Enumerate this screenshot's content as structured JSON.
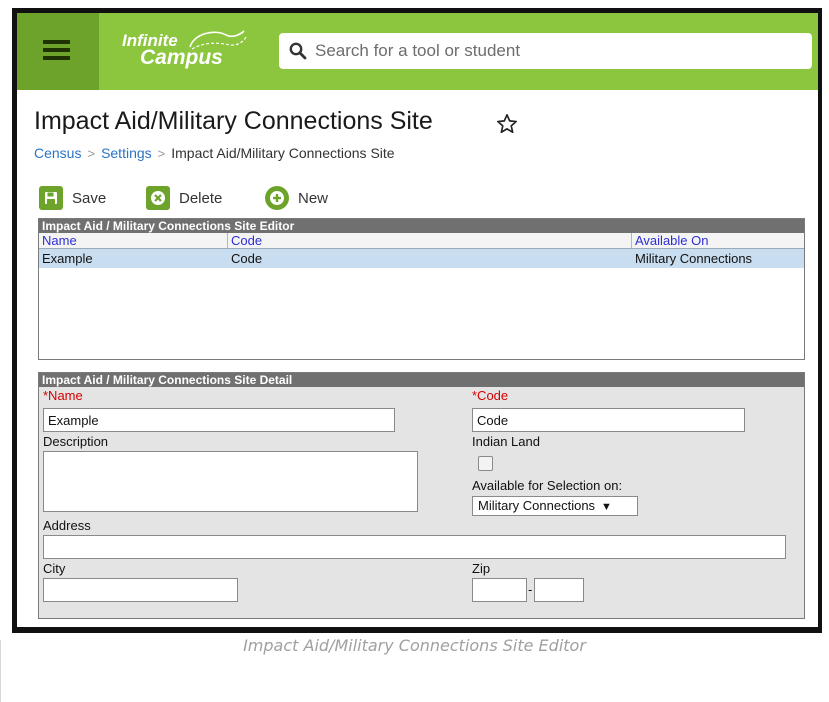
{
  "header": {
    "logo_line1": "Infinite",
    "logo_line2": "Campus",
    "search_placeholder": "Search for a tool or student",
    "brand_color": "#8cc63e"
  },
  "page": {
    "title": "Impact Aid/Military Connections Site",
    "breadcrumb": [
      "Census",
      "Settings",
      "Impact Aid/Military Connections Site"
    ]
  },
  "toolbar": {
    "save_label": "Save",
    "delete_label": "Delete",
    "new_label": "New"
  },
  "editor": {
    "title": "Impact Aid / Military Connections Site Editor",
    "columns": [
      "Name",
      "Code",
      "Available On"
    ],
    "rows": [
      {
        "name": "Example",
        "code": "Code",
        "available_on": "Military Connections"
      }
    ]
  },
  "detail": {
    "title": "Impact Aid / Military Connections Site Detail",
    "name_label": "*Name",
    "name_value": "Example",
    "code_label": "*Code",
    "code_value": "Code",
    "description_label": "Description",
    "description_value": "",
    "indian_land_label": "Indian Land",
    "indian_land_checked": false,
    "available_label": "Available for Selection on:",
    "available_value": "Military Connections",
    "address_label": "Address",
    "address_value": "",
    "city_label": "City",
    "city_value": "",
    "zip_label": "Zip",
    "zip_value": "",
    "zip_ext_value": "",
    "zip_separator": "-"
  },
  "caption": "Impact Aid/Military Connections Site Editor"
}
